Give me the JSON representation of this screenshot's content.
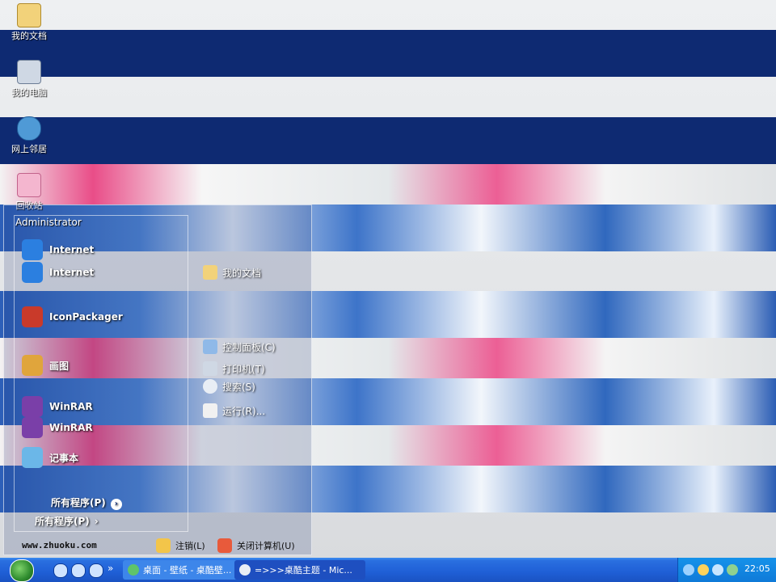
{
  "desktop": {
    "icons": [
      {
        "label": "我的文档",
        "icon": "folder-icon"
      },
      {
        "label": "我的电脑",
        "icon": "computer-icon"
      },
      {
        "label": "网上邻居",
        "icon": "network-icon"
      },
      {
        "label": "回收站",
        "icon": "recycle-bin-icon"
      }
    ]
  },
  "start_menu": {
    "user": "Administrator",
    "programs": [
      {
        "label": "Internet",
        "icon": "internet-explorer-icon",
        "color": "#2b7fe0"
      },
      {
        "label": "Internet",
        "icon": "internet-explorer-icon",
        "color": "#2b7fe0"
      },
      {
        "label": "IconPackager",
        "icon": "iconpackager-icon",
        "color": "#c93a2a"
      },
      {
        "label": "画图",
        "icon": "paint-icon",
        "color": "#e0a53c"
      },
      {
        "label": "WinRAR",
        "icon": "winrar-icon",
        "color": "#7a3fa8"
      },
      {
        "label": "WinRAR",
        "icon": "winrar-icon",
        "color": "#7a3fa8"
      },
      {
        "label": "记事本",
        "icon": "notepad-icon",
        "color": "#6bb7e8"
      }
    ],
    "places": [
      {
        "label": "我的文档",
        "icon": "folder-icon"
      },
      {
        "label": "控制面板(C)",
        "icon": "control-panel-icon"
      },
      {
        "label": "打印机(T)",
        "icon": "printer-icon"
      },
      {
        "label": "搜索(S)",
        "icon": "search-icon"
      },
      {
        "label": "运行(R)...",
        "icon": "run-icon"
      }
    ],
    "all_programs": "所有程序(P)",
    "all_programs_arrow": "›",
    "logoff": "注销(L)",
    "shutdown": "关闭计算机(U)",
    "site_url": "www.zhuoku.com"
  },
  "taskbar": {
    "chevron": "»",
    "tasks": [
      {
        "label": "桌面 - 壁纸 - 桌酷壁...",
        "icon": "ie-icon"
      },
      {
        "label": "=>>>桌酷主题 - Mic...",
        "icon": "ie-icon"
      }
    ],
    "clock": "22:05"
  }
}
